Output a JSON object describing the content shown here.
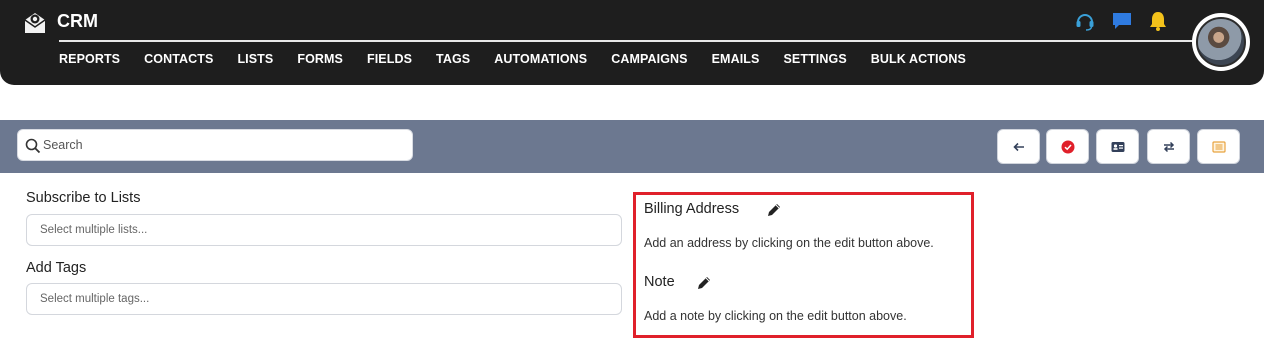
{
  "app": {
    "brand": "CRM"
  },
  "nav": {
    "items": [
      "REPORTS",
      "CONTACTS",
      "LISTS",
      "FORMS",
      "FIELDS",
      "TAGS",
      "AUTOMATIONS",
      "CAMPAIGNS",
      "EMAILS",
      "SETTINGS",
      "BULK ACTIONS"
    ]
  },
  "header_icons": {
    "support": "headset-icon",
    "chat": "chat-icon",
    "notifications": "bell-icon",
    "colors": {
      "support": "#3aa0d8",
      "chat": "#2f7be0",
      "bell": "#f3c21b"
    }
  },
  "toolbar": {
    "search_placeholder": "Search",
    "buttons": [
      "back-arrow-icon",
      "check-circle-icon",
      "id-card-icon",
      "swap-icon",
      "list-icon"
    ],
    "colors": {
      "bar": "#6c7890",
      "check": "#e0202a",
      "list": "#e8a340"
    }
  },
  "form": {
    "subscribe_label": "Subscribe to Lists",
    "subscribe_placeholder": "Select multiple lists...",
    "tags_label": "Add Tags",
    "tags_placeholder": "Select multiple tags..."
  },
  "panel": {
    "billing_title": "Billing Address",
    "billing_text": "Add an address by clicking on the edit button above.",
    "note_title": "Note",
    "note_text": "Add a note by clicking on the edit button above.",
    "highlight_color": "#e0202a"
  }
}
